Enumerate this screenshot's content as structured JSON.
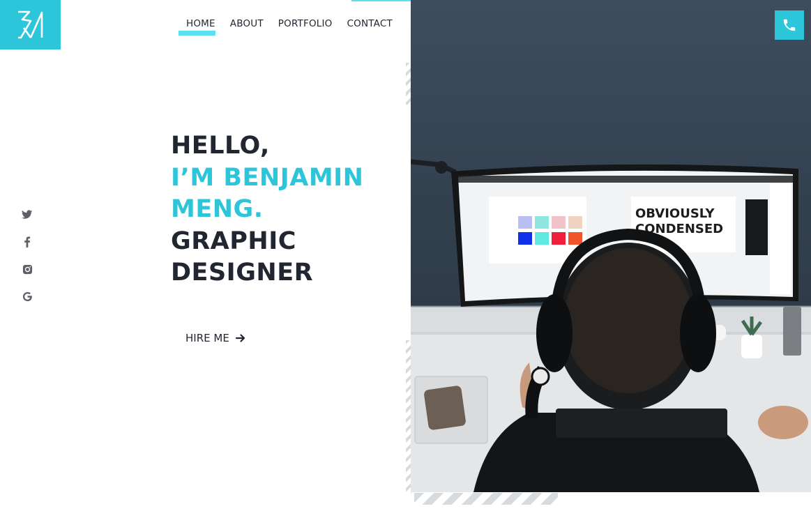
{
  "brand": {
    "logo_text": "BM",
    "accent_color": "#2cc5d9",
    "highlight_color": "#5ce0ee"
  },
  "nav": {
    "items": [
      {
        "label": "HOME",
        "active": true
      },
      {
        "label": "ABOUT",
        "active": false
      },
      {
        "label": "PORTFOLIO",
        "active": false
      },
      {
        "label": "CONTACT",
        "active": false
      }
    ]
  },
  "hero": {
    "line1": "HELLO,",
    "line2": "I’M BENJAMIN",
    "line3": "MENG.",
    "line4": "GRAPHIC",
    "line5": "DESIGNER",
    "cta_label": "HIRE ME"
  },
  "socials": [
    "twitter-icon",
    "facebook-icon",
    "instagram-icon",
    "google-icon"
  ],
  "photo": {
    "monitor_headline_1": "OBVIOUSLY",
    "monitor_headline_2": "CONDENSED"
  }
}
